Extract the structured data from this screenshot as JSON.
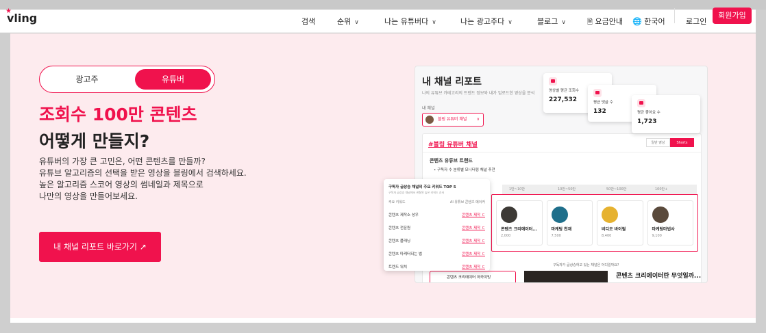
{
  "header": {
    "logo_text": "vling",
    "nav": [
      {
        "label": "검색",
        "has_menu": false
      },
      {
        "label": "순위",
        "has_menu": true
      },
      {
        "label": "나는 유튜버다",
        "has_menu": true
      },
      {
        "label": "나는 광고주다",
        "has_menu": true
      },
      {
        "label": "블로그",
        "has_menu": true
      }
    ],
    "pricing": "요금안내",
    "language": "한국어",
    "login": "로그인",
    "signup": "회원가입"
  },
  "hero": {
    "toggle": {
      "advertiser": "광고주",
      "youtuber": "유튜버",
      "selected": "유튜버"
    },
    "headline_accent": "조회수 100만 콘텐츠",
    "headline": "어떻게 만들지?",
    "description": [
      "유튜버의 가장 큰 고민은, 어떤 콘텐츠를 만들까?",
      "유튜브 알고리즘의 선택을 받은 영상을 블링에서 검색하세요.",
      "높은 알고리즘 스코어 영상의 썸네일과 제목으로",
      "나만의 영상을 만들어보세요."
    ],
    "cta": "내 채널 리포트 바로가기 ↗"
  },
  "report": {
    "title": "내 채널 리포트",
    "subtitle": "나의 유튜브 카테고리의 트렌드 정보와 내가 업로드한 영상을 분석",
    "channel_label": "내 채널",
    "channel_name": "블링 유튜버 채널",
    "panel_heading": "#블링 유튜버 채널",
    "tabs": [
      "일반 영상",
      "Shorts"
    ],
    "section": "콘텐츠 유튜브 트렌드",
    "bullet": "• 구독자 수 분류별 모니터링 채널 추천",
    "grid_headers": [
      "1만~10만",
      "10만~50만",
      "50만~100만",
      "100만+"
    ],
    "cards": [
      {
        "name": "콘텐츠 크리에이터...",
        "count": "2,000",
        "color": "#3d3a36"
      },
      {
        "name": "마케팅 천재",
        "count": "7,500",
        "color": "#1f6f8b"
      },
      {
        "name": "비디오 바이럴",
        "count": "8,400",
        "color": "#e6b230"
      },
      {
        "name": "마케팅마법사",
        "count": "9,100",
        "color": "#5a4a3c"
      }
    ],
    "question": "구독자가 급상승하고 있는 채널은 어디일까요?",
    "bottom_tag": "콘텐츠 크리에이터 아카이빙",
    "bottom_title": "콘텐츠 크리에이터란 무엇일까..."
  },
  "stats": [
    {
      "label": "영상별 평균 조회수",
      "value": "227,532"
    },
    {
      "label": "평균 댓글 수",
      "value": "132"
    },
    {
      "label": "평균 좋아요 수",
      "value": "1,723"
    }
  ],
  "keywords": {
    "title": "구독자 급상승 채널의 주요 키워드 TOP 5",
    "subtitle": "구독자 급상승 채널에서 관찰된 높은 키워드 순서",
    "col_left": "주요 키워드",
    "col_right": "AI 유튜브 콘텐츠 메이커",
    "rows": [
      {
        "kw": "콘텐츠 제작소 성우",
        "link": "콘텐츠 제작 ㄷ"
      },
      {
        "kw": "콘텐츠 전문원",
        "link": "콘텐츠 제작 ㄷ"
      },
      {
        "kw": "콘텐츠 플래닝",
        "link": "콘텐츠 제작 ㄷ"
      },
      {
        "kw": "콘텐츠 마케터되는 법",
        "link": "콘텐츠 제작 ㄷ"
      },
      {
        "kw": "트렌드 워치",
        "link": "콘텐츠 제작 ㄷ"
      }
    ]
  }
}
